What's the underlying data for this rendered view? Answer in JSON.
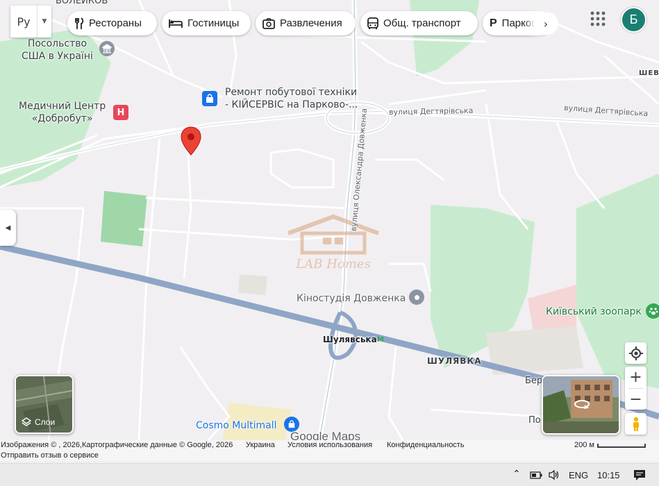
{
  "topbar": {
    "language": "Ру",
    "chips": [
      {
        "label": "Рестораны",
        "icon": "fork-knife-icon"
      },
      {
        "label": "Гостиницы",
        "icon": "bed-icon"
      },
      {
        "label": "Развлечения",
        "icon": "camera-icon"
      },
      {
        "label": "Общ. транспорт",
        "icon": "bus-icon"
      },
      {
        "label": "Парковки",
        "icon": "parking-icon"
      }
    ],
    "avatar_letter": "Б"
  },
  "map": {
    "labels": {
      "top_cut": "ВОЛЕЙКОВ",
      "embassy": "Посольство\nСША в Україні",
      "medical": "Медичний Центр\n«Добробут»",
      "repair": "Ремонт побутової техніки\n- КІЙСЕРВІС на Парково-...",
      "street_degt1": "вулиця Дегтярівська",
      "street_degt2": "вулиця Дегтярівська",
      "street_dovzh": "вулиця Олександра Довженка",
      "shev": "ШЕВ",
      "kinostudia": "Кіностудія Довженка",
      "zoo": "Київський зоопарк",
      "shuliavska": "Шулявська",
      "shuliavka": "ШУЛЯВКА",
      "ber": "Бер",
      "po": "По",
      "cosmo": "Cosmo Multimall",
      "google_maps": "Google Maps",
      "watermark": "LAB Homes",
      "metro_symbol": "M"
    }
  },
  "layers_label": "Слои",
  "footer": {
    "attribution": "Изображения © , 2026,Картографические данные © Google, 2026",
    "ukraine": "Украина",
    "terms": "Условия использования",
    "privacy": "Конфиденциальность",
    "scale": "200 м",
    "feedback": "Отправить отзыв о сервисе"
  },
  "taskbar": {
    "lang": "ENG",
    "time": "10:15"
  },
  "colors": {
    "park": "#c8ebcf",
    "highway": "#8fa5c6",
    "road": "#ffffff",
    "pin": "#ea4335",
    "avatar": "#1a7f73"
  }
}
